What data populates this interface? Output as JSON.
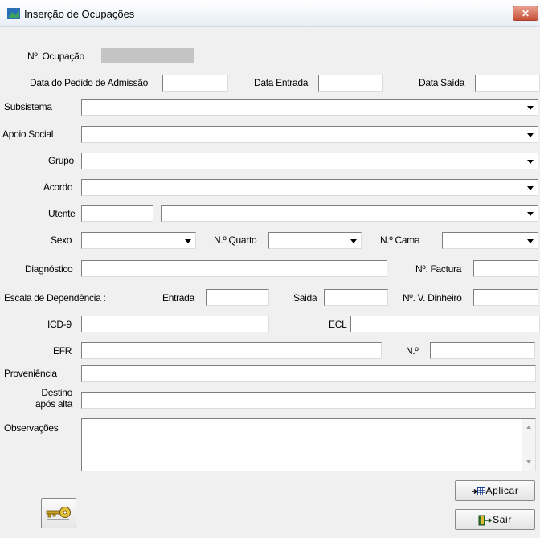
{
  "window": {
    "title": "Inserção de Ocupações",
    "close_glyph": "✕"
  },
  "labels": {
    "n_ocupacao": "Nº. Ocupação",
    "data_pedido": "Data do Pedido de Admissão",
    "data_entrada": "Data Entrada",
    "data_saida": "Data Saída",
    "subsistema": "Subsistema",
    "apoio_social": "Apoio Social",
    "grupo": "Grupo",
    "acordo": "Acordo",
    "utente": "Utente",
    "sexo": "Sexo",
    "n_quarto": "N.º Quarto",
    "n_cama": "N.º Cama",
    "diagnostico": "Diagnóstico",
    "n_factura": "Nº. Factura",
    "escala": "Escala de Dependência :",
    "entrada": "Entrada",
    "saida": "Saida",
    "n_v_dinheiro": "Nº. V. Dinheiro",
    "icd9": "ICD-9",
    "ecl": "ECL",
    "efr": "EFR",
    "n": "N.º",
    "proveniencia": "Proveniência",
    "destino_1": "Destino",
    "destino_2": "após alta",
    "observacoes": "Observações"
  },
  "values": {
    "n_ocupacao": "",
    "data_pedido": "",
    "data_entrada": "",
    "data_saida": "",
    "subsistema": "",
    "apoio_social": "",
    "grupo": "",
    "acordo": "",
    "utente_code": "",
    "utente_name": "",
    "sexo": "",
    "n_quarto": "",
    "n_cama": "",
    "diagnostico": "",
    "n_factura": "",
    "escala_entrada": "",
    "escala_saida": "",
    "n_v_dinheiro": "",
    "icd9": "",
    "ecl": "",
    "efr": "",
    "n": "",
    "proveniencia": "",
    "destino": "",
    "observacoes": ""
  },
  "buttons": {
    "aplicar": "Aplicar",
    "sair": "Sair"
  },
  "icons": {
    "app": "app-icon",
    "close": "close-icon",
    "dropdown": "chevron-down-icon",
    "aplicar": "table-arrow-icon",
    "sair": "exit-door-icon",
    "key": "key-icon"
  },
  "colors": {
    "background": "#f0f0f0",
    "close_button": "#c7513a",
    "readonly_field": "#c4c4c4"
  }
}
